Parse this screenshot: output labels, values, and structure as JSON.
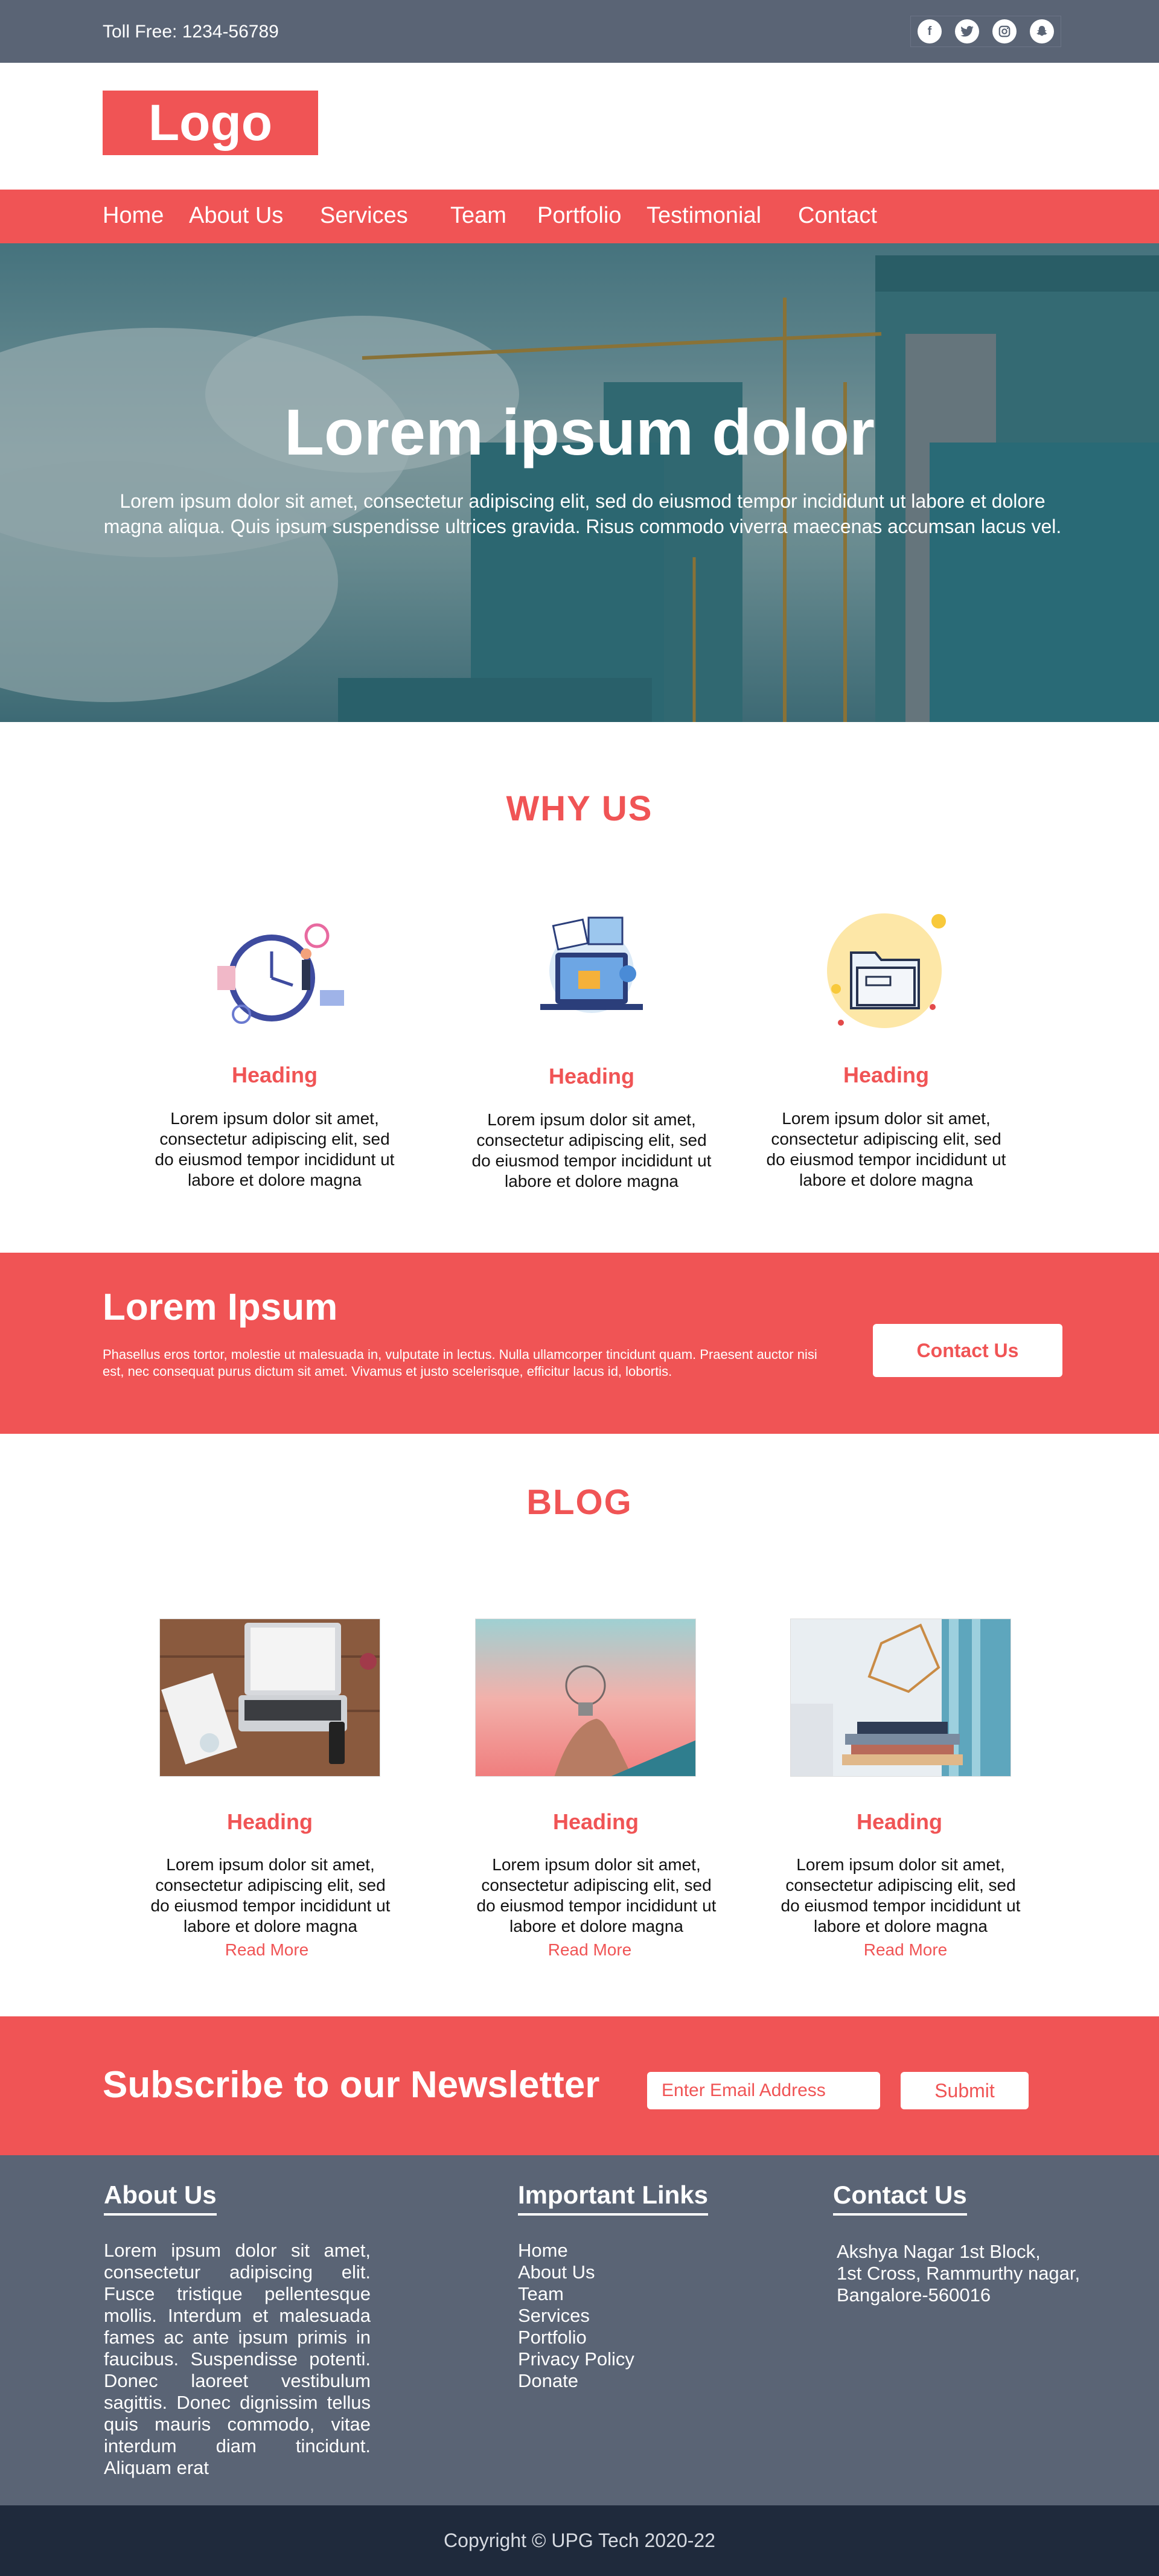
{
  "topbar": {
    "toll_free": "Toll Free: 1234-56789",
    "social_icons": [
      "facebook-icon",
      "twitter-icon",
      "instagram-icon",
      "snapchat-icon"
    ]
  },
  "logo": {
    "text": "Logo"
  },
  "nav": {
    "items": [
      "Home",
      "About Us",
      "Services",
      "Team",
      "Portfolio",
      "Testimonial",
      "Contact"
    ]
  },
  "hero": {
    "title": "Lorem ipsum dolor",
    "text": "Lorem ipsum dolor sit amet, consectetur adipiscing elit, sed do eiusmod tempor incididunt ut labore et dolore magna aliqua. Quis ipsum suspendisse ultrices gravida. Risus commodo viverra maecenas accumsan lacus vel."
  },
  "why_us": {
    "title": "WHY US",
    "cards": [
      {
        "icon": "clock-icon",
        "heading": "Heading",
        "text": "Lorem ipsum dolor sit amet, consectetur adipiscing elit, sed do eiusmod tempor incididunt ut labore et dolore magna"
      },
      {
        "icon": "laptop-photos-icon",
        "heading": "Heading",
        "text": "Lorem ipsum dolor sit amet, consectetur adipiscing elit, sed do eiusmod tempor incididunt ut labore et dolore magna"
      },
      {
        "icon": "folder-icon",
        "heading": "Heading",
        "text": "Lorem ipsum dolor sit amet, consectetur adipiscing elit, sed do eiusmod tempor incididunt ut labore et dolore magna"
      }
    ]
  },
  "cta": {
    "title": "Lorem Ipsum",
    "text": "Phasellus eros tortor, molestie ut malesuada in, vulputate in lectus. Nulla ullamcorper tincidunt quam. Praesent auctor nisi est, nec consequat purus dictum sit amet. Vivamus et justo scelerisque, efficitur lacus id, lobortis.",
    "button": "Contact Us"
  },
  "blog": {
    "title": "BLOG",
    "posts": [
      {
        "image": "laptop-desk-photo",
        "heading": "Heading",
        "text": "Lorem ipsum dolor sit amet, consectetur adipiscing elit, sed do eiusmod tempor incididunt ut labore et dolore magna",
        "read_more": "Read More"
      },
      {
        "image": "lightbulb-hand-photo",
        "heading": "Heading",
        "text": "Lorem ipsum dolor sit amet, consectetur adipiscing elit, sed do eiusmod tempor incididunt ut labore et dolore magna",
        "read_more": "Read More"
      },
      {
        "image": "books-lamp-photo",
        "heading": "Heading",
        "text": "Lorem ipsum dolor sit amet, consectetur adipiscing elit, sed do eiusmod tempor incididunt ut labore et dolore magna",
        "read_more": "Read More"
      }
    ]
  },
  "newsletter": {
    "title": "Subscribe to our Newsletter",
    "placeholder": "Enter Email Address",
    "button": "Submit"
  },
  "footer": {
    "about": {
      "heading": "About Us",
      "text": "Lorem ipsum dolor sit amet, consectetur adipiscing elit. Fusce tristique pellentesque mollis. Interdum et malesuada fames ac ante ipsum primis in faucibus. Suspendisse potenti. Donec laoreet vestibulum sagittis. Donec dignissim tellus quis mauris commodo, vitae interdum diam tincidunt. Aliquam erat"
    },
    "links": {
      "heading": "Important Links",
      "items": [
        "Home",
        "About Us",
        "Team",
        "Services",
        "Portfolio",
        "Privacy Policy",
        "Donate"
      ]
    },
    "contact": {
      "heading": "Contact Us",
      "lines": [
        "Akshya Nagar 1st Block,",
        "1st Cross, Rammurthy nagar,",
        "Bangalore-560016"
      ]
    }
  },
  "copyright": "Copyright © UPG Tech 2020-22",
  "colors": {
    "accent": "#f05455",
    "slate": "#5a6475",
    "dark": "#1f2a3c"
  }
}
